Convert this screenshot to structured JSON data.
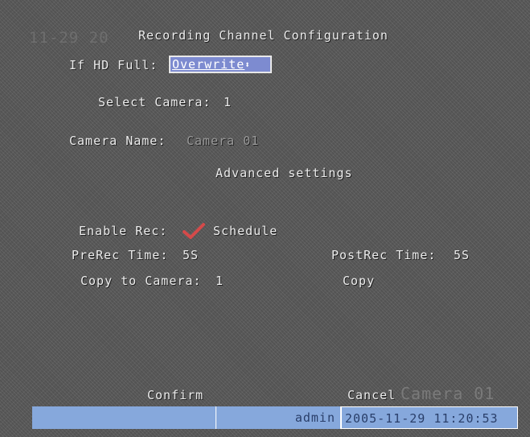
{
  "osd_overlay": {
    "date_fragment": "11-29 20",
    "camera_watermark": "Camera 01"
  },
  "dialog": {
    "title": "Recording Channel Configuration",
    "hd_full_label": "If HD Full:",
    "hd_full_value": "Overwrite",
    "select_camera_label": "Select Camera:",
    "select_camera_value": "1",
    "camera_name_label": "Camera Name:",
    "camera_name_value": "Camera 01",
    "advanced_settings": "Advanced settings",
    "enable_rec_label": "Enable Rec:",
    "schedule_label": "Schedule",
    "prerec_label": "PreRec Time:",
    "prerec_value": "5S",
    "postrec_label": "PostRec Time:",
    "postrec_value": "5S",
    "copy_to_camera_label": "Copy to Camera:",
    "copy_to_camera_value": "1",
    "copy_button": "Copy",
    "confirm_button": "Confirm",
    "cancel_button": "Cancel"
  },
  "status_bar": {
    "user": "admin",
    "datetime": "2005-11-29 11:20:53"
  },
  "colors": {
    "selection": "#7d8bd0",
    "status_bar": "#86a8dc",
    "check": "#d44a4a"
  },
  "icons": {
    "dropdown_arrows": "⬍",
    "enable_rec_check": "check-icon"
  }
}
